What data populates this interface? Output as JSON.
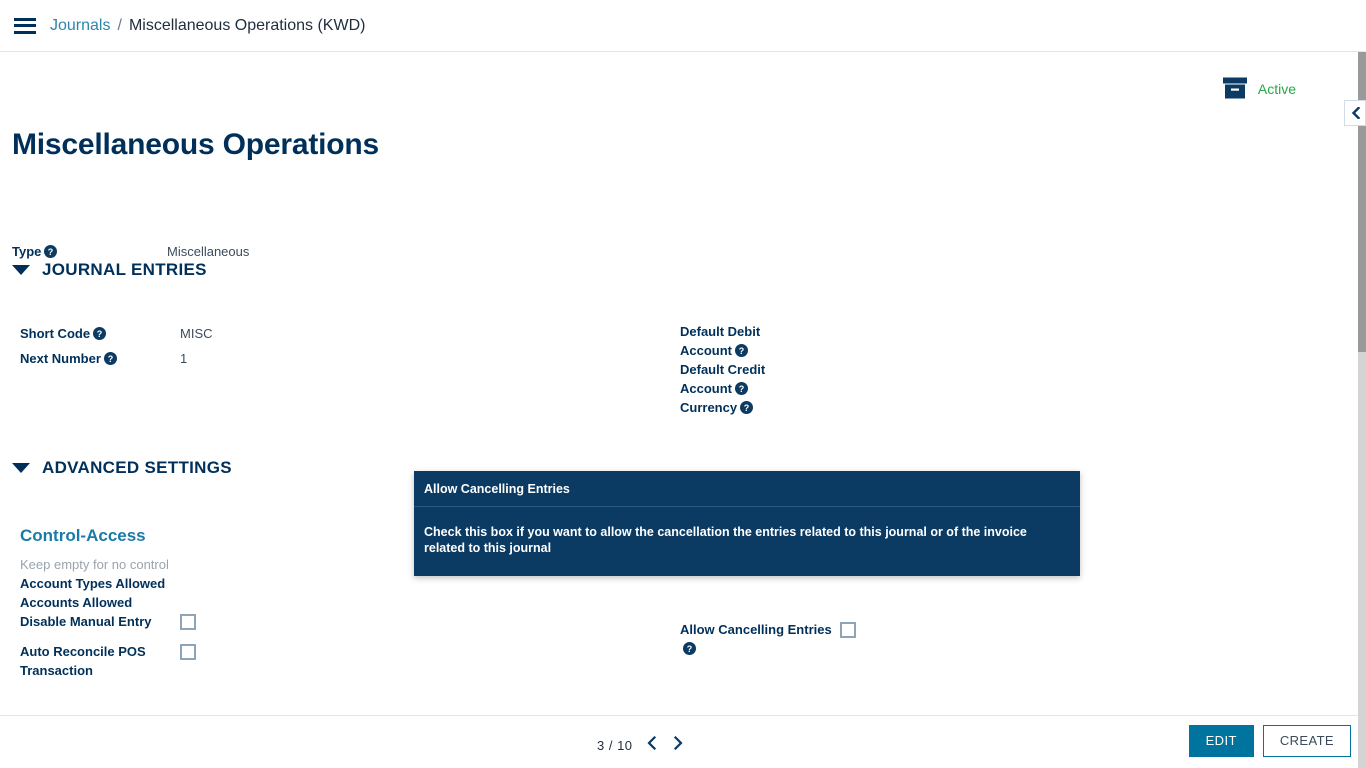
{
  "breadcrumb": {
    "menu_icon": "hamburger-icon",
    "parent": "Journals",
    "separator": "/",
    "current": "Miscellaneous Operations (KWD)"
  },
  "status": {
    "icon": "archive-box-icon",
    "label": "Active",
    "color": "#28a745"
  },
  "collapse": {
    "icon": "chevron-left-icon"
  },
  "record": {
    "title": "Miscellaneous Operations",
    "type_label": "Type",
    "type_value": "Miscellaneous"
  },
  "sections": {
    "journal_entries": {
      "title": "JOURNAL ENTRIES",
      "caret_icon": "caret-down-icon",
      "left_fields": [
        {
          "label": "Short Code",
          "value": "MISC",
          "help": true
        },
        {
          "label": "Next Number",
          "value": "1",
          "help": true
        }
      ],
      "right_fields": [
        {
          "label": "Default Debit Account",
          "value": "",
          "help": true
        },
        {
          "label": "Default Credit Account",
          "value": "",
          "help": true
        },
        {
          "label": "Currency",
          "value": "",
          "help": true
        }
      ]
    },
    "advanced_settings": {
      "title": "ADVANCED SETTINGS",
      "caret_icon": "caret-down-icon",
      "control_access": {
        "heading": "Control-Access",
        "subtitle": "Keep empty for no control",
        "fields": [
          {
            "label": "Account Types Allowed",
            "value": "",
            "type": "text"
          },
          {
            "label": "Accounts Allowed",
            "value": "",
            "type": "text"
          },
          {
            "label": "Disable Manual Entry",
            "checked": false,
            "type": "checkbox"
          },
          {
            "label": "Auto Reconcile POS Transaction",
            "checked": false,
            "type": "checkbox"
          }
        ]
      },
      "right_fields": [
        {
          "label": "Allow Cancelling Entries",
          "checked": false,
          "help": true,
          "type": "checkbox"
        }
      ]
    }
  },
  "tooltip": {
    "title": "Allow Cancelling Entries",
    "body": "Check this box if you want to allow the cancellation the entries related to this journal or of the invoice related to this journal"
  },
  "footer": {
    "pager_count": "3 / 10",
    "prev_icon": "chevron-left-icon",
    "next_icon": "chevron-right-icon",
    "edit_label": "EDIT",
    "create_label": "CREATE",
    "accent_color": "#00749f"
  }
}
